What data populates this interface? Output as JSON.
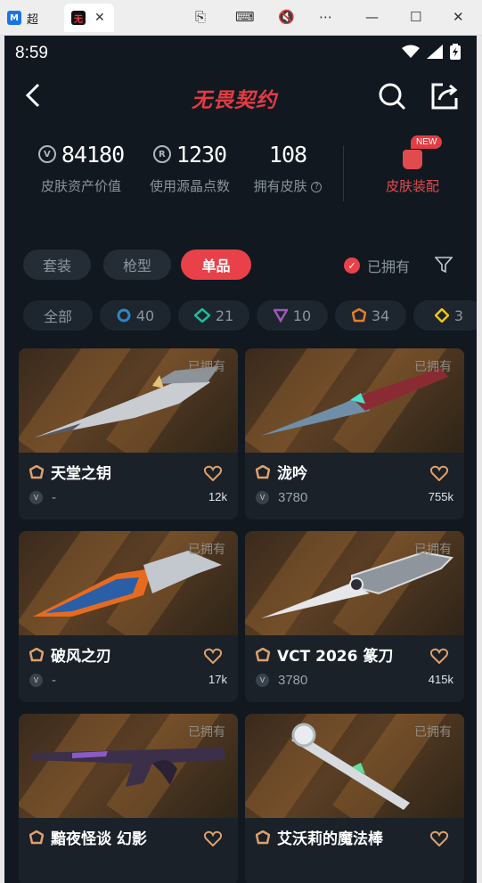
{
  "browser": {
    "tabs": [
      {
        "title": "超",
        "favicon": "M"
      },
      {
        "title": "",
        "favicon": "无"
      }
    ],
    "controls": [
      "screenshot-icon",
      "keyboard-icon",
      "mute-icon",
      "more-icon",
      "minimize-icon",
      "maximize-icon",
      "close-icon"
    ]
  },
  "status": {
    "time": "8:59"
  },
  "header": {
    "logo": "无畏契约"
  },
  "stats": [
    {
      "value": "84180",
      "label": "皮肤资产价值",
      "icon": "V"
    },
    {
      "value": "1230",
      "label": "使用源晶点数",
      "icon": "R"
    },
    {
      "value": "108",
      "label": "拥有皮肤",
      "icon": ""
    }
  ],
  "outfit": {
    "label": "皮肤装配",
    "badge": "NEW"
  },
  "type_tabs": [
    {
      "label": "套装"
    },
    {
      "label": "枪型"
    },
    {
      "label": "单品"
    }
  ],
  "owned_filter": {
    "label": "已拥有"
  },
  "rarity": [
    {
      "label": "全部"
    },
    {
      "label": "40",
      "color": "#2e86c1"
    },
    {
      "label": "21",
      "color": "#1abc9c"
    },
    {
      "label": "10",
      "color": "#9b59b6"
    },
    {
      "label": "34",
      "color": "#e67e22"
    },
    {
      "label": "3",
      "color": "#f1c40f"
    }
  ],
  "cards": [
    {
      "name": "天堂之钥",
      "price": "-",
      "likes": "12k",
      "owned": "已拥有"
    },
    {
      "name": "泷吟",
      "price": "3780",
      "likes": "755k",
      "owned": "已拥有"
    },
    {
      "name": "破风之刃",
      "price": "-",
      "likes": "17k",
      "owned": "已拥有"
    },
    {
      "name": "VCT 2026 篆刀",
      "price": "3780",
      "likes": "415k",
      "owned": "已拥有"
    },
    {
      "name": "黯夜怪谈 幻影",
      "price": "",
      "likes": "",
      "owned": "已拥有"
    },
    {
      "name": "艾沃莉的魔法棒",
      "price": "",
      "likes": "",
      "owned": "已拥有"
    }
  ],
  "colors": {
    "accent": "#e8414a",
    "bg": "#111820",
    "card": "#1a2129",
    "tier": "#e0a06a"
  }
}
